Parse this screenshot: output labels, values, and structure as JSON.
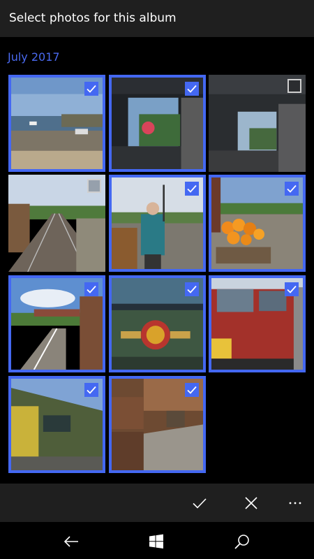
{
  "header": {
    "title": "Select photos for this album"
  },
  "section": {
    "label": "July 2017"
  },
  "photos": [
    {
      "name": "harbour",
      "selected": true
    },
    {
      "name": "tunnel-garden",
      "selected": true
    },
    {
      "name": "tunnel",
      "selected": false
    },
    {
      "name": "railway-tracks",
      "selected": false
    },
    {
      "name": "man-on-platform",
      "selected": true
    },
    {
      "name": "flowers-platform",
      "selected": true
    },
    {
      "name": "footbridge-station",
      "selected": true
    },
    {
      "name": "british-railways-emblem",
      "selected": true
    },
    {
      "name": "red-diesel-locomotive",
      "selected": true
    },
    {
      "name": "green-diesel-locomotive",
      "selected": true
    },
    {
      "name": "luggage-platform",
      "selected": true
    }
  ],
  "appbar": {
    "accept_icon": "checkmark-icon",
    "cancel_icon": "close-icon",
    "more_icon": "more-icon"
  },
  "navbar": {
    "back_icon": "back-arrow-icon",
    "home_icon": "windows-logo-icon",
    "search_icon": "search-icon"
  },
  "colors": {
    "accent": "#4468f2",
    "section_label": "#4a6af0",
    "bar_bg": "#1f1f1f"
  }
}
